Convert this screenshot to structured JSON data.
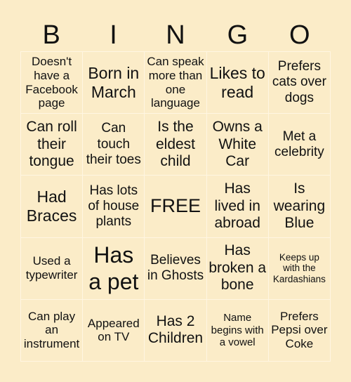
{
  "header": {
    "letters": [
      "B",
      "I",
      "N",
      "G",
      "O"
    ]
  },
  "cells": [
    "Doesn't have a Facebook page",
    "Born in March",
    "Can speak more than one language",
    "Likes to read",
    "Prefers cats over dogs",
    "Can roll their tongue",
    "Can touch their toes",
    "Is the eldest child",
    "Owns a White Car",
    "Met a celebrity",
    "Had Braces",
    "Has lots of house plants",
    "FREE",
    "Has lived in abroad",
    "Is wearing Blue",
    "Used a typewriter",
    "Has a pet",
    "Believes in Ghosts",
    "Has broken a bone",
    "Keeps up with the Kardashians",
    "Can play an instrument",
    "Appeared on TV",
    "Has 2 Children",
    "Name begins with a vowel",
    "Prefers Pepsi over Coke"
  ]
}
